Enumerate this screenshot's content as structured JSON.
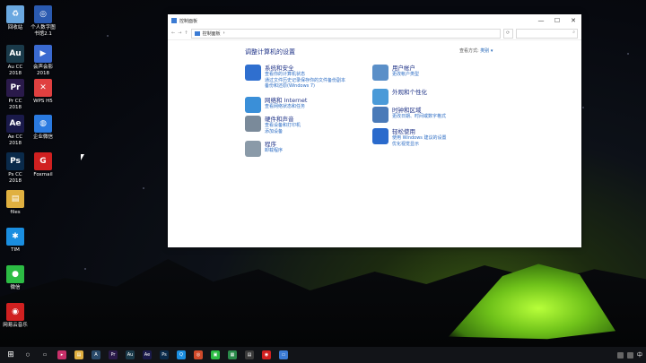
{
  "desktop": {
    "icons": [
      {
        "label": "回收站",
        "color": "#6aa8e0",
        "glyph": "♻"
      },
      {
        "label": "Au CC 2018",
        "color": "#1a3a4a",
        "glyph": "Au"
      },
      {
        "label": "Pr CC 2018",
        "color": "#2a1a4a",
        "glyph": "Pr"
      },
      {
        "label": "Ae CC 2018",
        "color": "#1a1a4a",
        "glyph": "Ae"
      },
      {
        "label": "Ps CC 2018",
        "color": "#0a2a4a",
        "glyph": "Ps"
      },
      {
        "label": "files",
        "color": "#e0b040",
        "glyph": "▤"
      },
      {
        "label": "TIM",
        "color": "#1a8ee0",
        "glyph": "✱"
      },
      {
        "label": "微信",
        "color": "#2cbc44",
        "glyph": "●"
      },
      {
        "label": "网易云音乐",
        "color": "#d02020",
        "glyph": "◉"
      },
      {
        "label": "个人数字图书馆2.1",
        "color": "#2a5ab0",
        "glyph": "◎"
      },
      {
        "label": "会声会影2018",
        "color": "#3a6ad0",
        "glyph": "▶"
      },
      {
        "label": "WPS H5",
        "color": "#e04040",
        "glyph": "✕"
      },
      {
        "label": "企业微信",
        "color": "#2a7ae0",
        "glyph": "◍"
      },
      {
        "label": "Foxmail",
        "color": "#d02020",
        "glyph": "G"
      }
    ]
  },
  "window": {
    "title": "控制面板",
    "controls": {
      "minimize": "—",
      "maximize": "☐",
      "close": "✕"
    },
    "address": "控制面板",
    "address_chevron": "›",
    "nav": {
      "back": "←",
      "forward": "→",
      "up": "↑"
    },
    "search_icon": "⌕",
    "heading": "调整计算机的设置",
    "view_by_label": "查看方式:",
    "view_by_value": "类别 ▾",
    "categories_left": [
      {
        "title": "系统和安全",
        "color": "#2f6fcf",
        "links": [
          "查看你的计算机状态",
          "通过文件历史记录保存你的文件备份副本",
          "备份和还原(Windows 7)"
        ]
      },
      {
        "title": "网络和 Internet",
        "color": "#3a8fd8",
        "links": [
          "查看网络状态和任务"
        ]
      },
      {
        "title": "硬件和声音",
        "color": "#7a8a9a",
        "links": [
          "查看设备和打印机",
          "添加设备"
        ]
      },
      {
        "title": "程序",
        "color": "#8a9aa8",
        "links": [
          "卸载程序"
        ]
      }
    ],
    "categories_right": [
      {
        "title": "用户帐户",
        "color": "#5a8fc8",
        "links": [
          "更改帐户类型"
        ]
      },
      {
        "title": "外观和个性化",
        "color": "#4a9ad8",
        "links": []
      },
      {
        "title": "时钟和区域",
        "color": "#4a7ab8",
        "links": [
          "更改日期、时间或数字格式"
        ]
      },
      {
        "title": "轻松使用",
        "color": "#2a6acc",
        "links": [
          "使用 Windows 建议的设置",
          "优化视觉显示"
        ]
      }
    ]
  },
  "taskbar": {
    "start_glyph": "⊞",
    "apps": [
      {
        "name": "search",
        "color": "#121418",
        "glyph": "○"
      },
      {
        "name": "task-view",
        "color": "#121418",
        "glyph": "▭"
      },
      {
        "name": "app-a",
        "color": "#c8306a",
        "glyph": "▸"
      },
      {
        "name": "files",
        "color": "#e0b040",
        "glyph": "▤"
      },
      {
        "name": "app-b",
        "color": "#2a4a6a",
        "glyph": "A"
      },
      {
        "name": "pr",
        "color": "#2a1a4a",
        "glyph": "Pr"
      },
      {
        "name": "au",
        "color": "#1a3a4a",
        "glyph": "Au"
      },
      {
        "name": "ae",
        "color": "#1a1a4a",
        "glyph": "Ae"
      },
      {
        "name": "ps",
        "color": "#0a2a4a",
        "glyph": "Ps"
      },
      {
        "name": "qq",
        "color": "#1a8ee0",
        "glyph": "Q"
      },
      {
        "name": "chrome",
        "color": "#d04a2a",
        "glyph": "◎"
      },
      {
        "name": "app-c",
        "color": "#2cbc44",
        "glyph": "▣"
      },
      {
        "name": "app-d",
        "color": "#2a8a4a",
        "glyph": "▦"
      },
      {
        "name": "app-e",
        "color": "#3a3a3a",
        "glyph": "▤"
      },
      {
        "name": "netease",
        "color": "#d02020",
        "glyph": "◉"
      },
      {
        "name": "control-panel",
        "color": "#3b7bd4",
        "glyph": "▭"
      }
    ],
    "ime": "中"
  }
}
